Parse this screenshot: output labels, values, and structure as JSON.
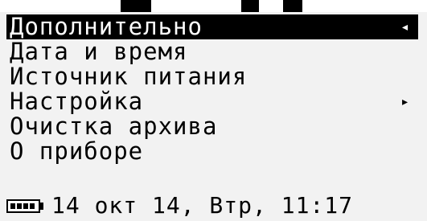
{
  "menu": {
    "items": [
      {
        "label": "Дополнительно",
        "arrow": "◂",
        "selected": true
      },
      {
        "label": "Дата и время",
        "arrow": "",
        "selected": false
      },
      {
        "label": "Источник питания",
        "arrow": "",
        "selected": false
      },
      {
        "label": "Настройка",
        "arrow": "▸",
        "selected": false
      },
      {
        "label": "Очистка архива",
        "arrow": "",
        "selected": false
      },
      {
        "label": "О приборе",
        "arrow": "",
        "selected": false
      }
    ]
  },
  "status": {
    "battery_icon": "battery-full-icon",
    "battery_level": 1.0,
    "datetime": "14 окт 14, Втр, 11:17"
  },
  "colors": {
    "screen_bg": "#f2f2f2",
    "text": "#000000",
    "highlight_bg": "#000000",
    "highlight_text": "#ffffff"
  }
}
